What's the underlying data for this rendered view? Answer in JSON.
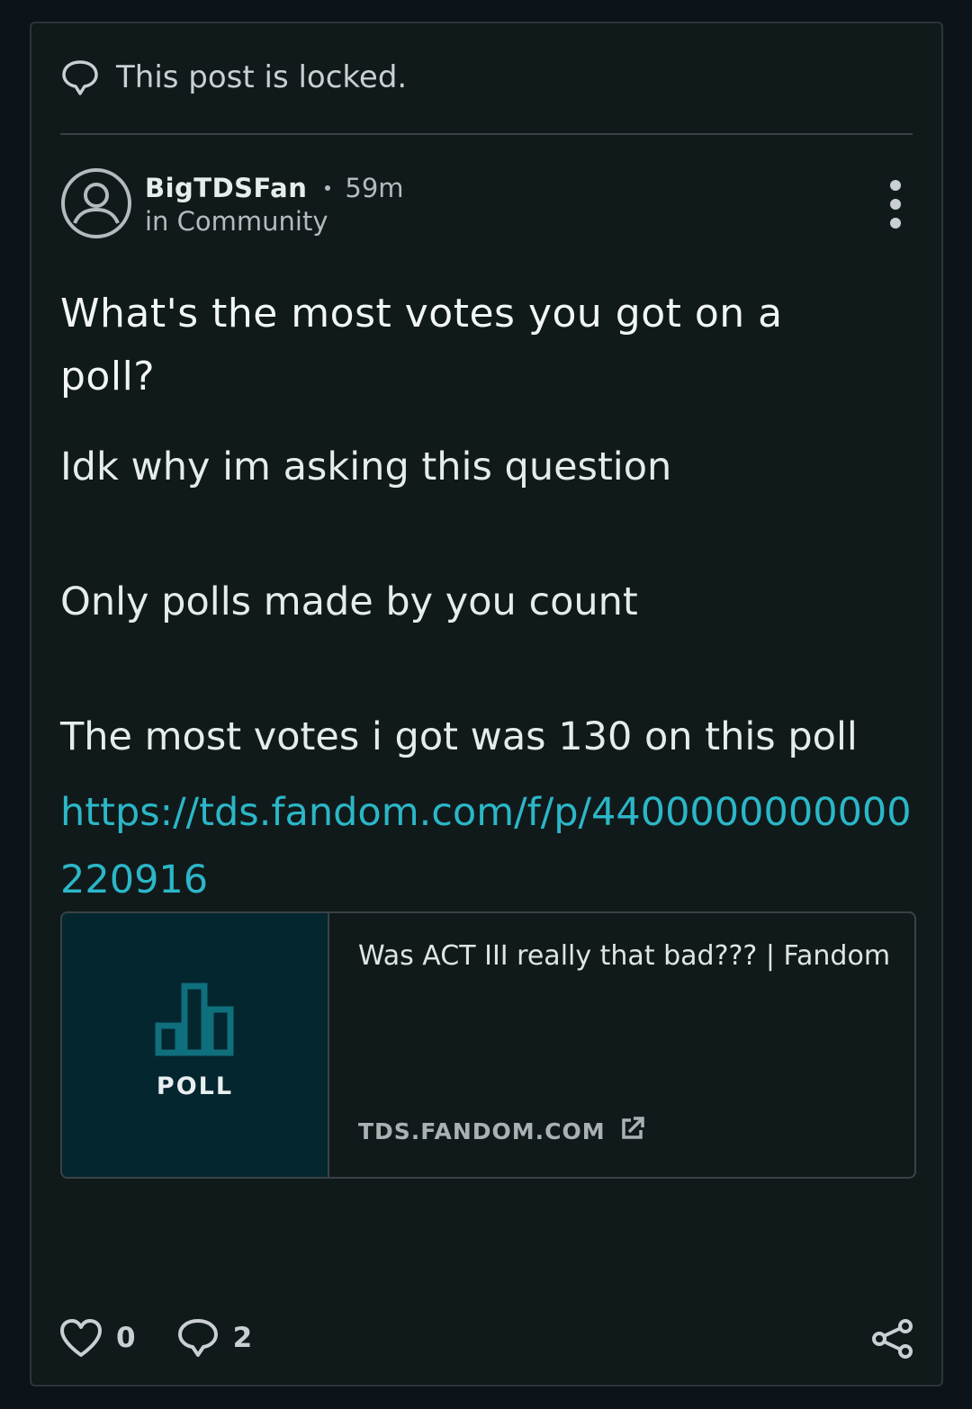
{
  "locked_notice": {
    "text": "This post is locked.",
    "icon": "speech-bubble-icon"
  },
  "post": {
    "author": "BigTDSFan",
    "time_ago": "59m",
    "community": "in Community",
    "title": "What's the most votes you got on a poll?",
    "body": [
      "Idk why im asking this question",
      "Only polls made by you count",
      "The most votes i got was 130 on this poll"
    ],
    "link": "https://tds.fandom.com/f/p/4400000000000220916"
  },
  "link_preview": {
    "thumbnail_label": "POLL",
    "thumbnail_icon": "bar-chart-icon",
    "title": "Was ACT III really that bad??? | Fandom",
    "domain": "TDS.FANDOM.COM"
  },
  "actions": {
    "likes": "0",
    "comments": "2"
  },
  "colors": {
    "background": "#0d1419",
    "card": "#111a1a",
    "link": "#2bb7c8",
    "thumbnail_bg": "#04262f",
    "poll_icon": "#0f6f7c"
  }
}
